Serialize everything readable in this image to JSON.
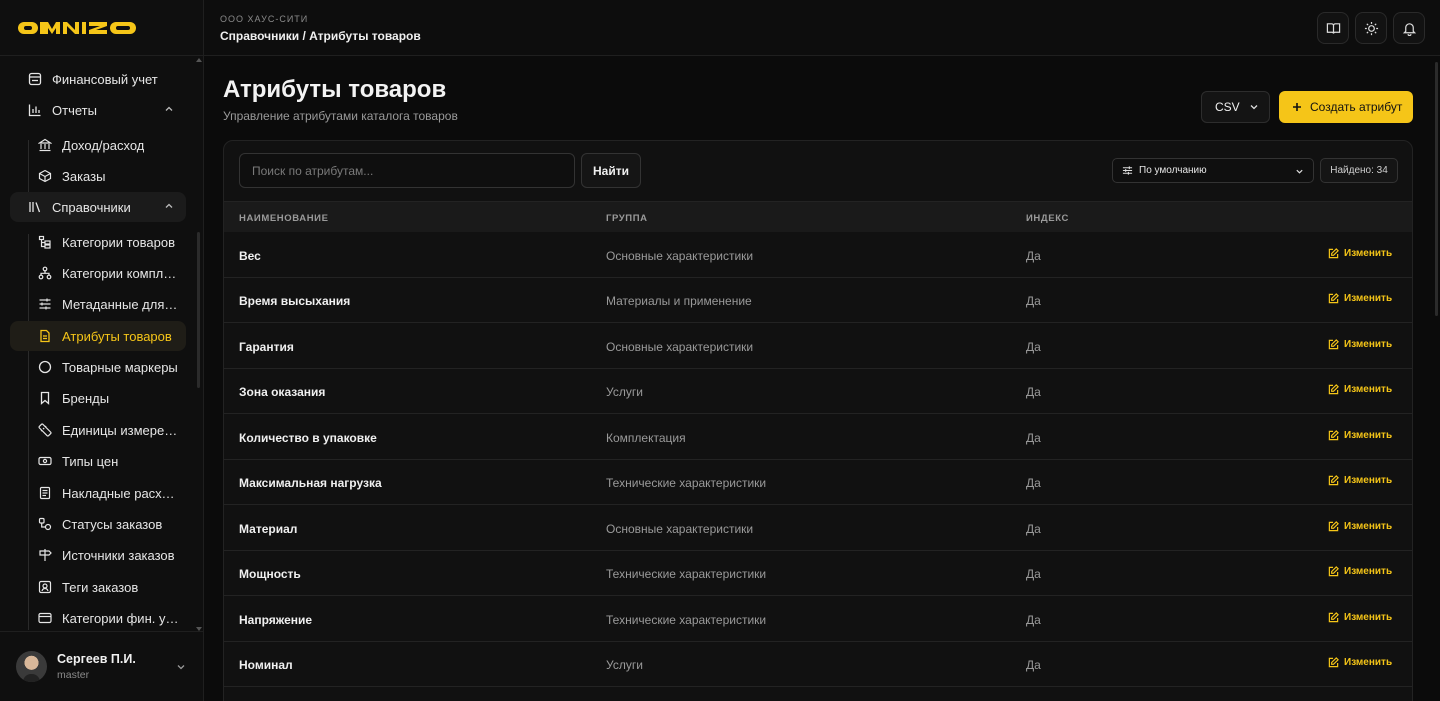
{
  "brand": {
    "logo_text": "OMNIZ",
    "accent": "#f5c518"
  },
  "header": {
    "org": "ООО ХАУС-СИТИ",
    "breadcrumb": "Справочники / Атрибуты товаров",
    "icons": [
      "book-icon",
      "sun-icon",
      "bell-icon"
    ]
  },
  "sidebar": {
    "items": [
      {
        "label": "Финансовый учет",
        "icon": "ledger-icon",
        "level": "top"
      },
      {
        "label": "Отчеты",
        "icon": "bar-chart-icon",
        "level": "top",
        "expanded": true
      },
      {
        "label": "Доход/расход",
        "icon": "bank-icon",
        "level": "sub"
      },
      {
        "label": "Заказы",
        "icon": "box-icon",
        "level": "sub"
      },
      {
        "label": "Справочники",
        "icon": "library-icon",
        "level": "top",
        "expanded": true
      },
      {
        "label": "Категории товаров",
        "icon": "category-tree-icon",
        "level": "sub"
      },
      {
        "label": "Категории комплектаций",
        "icon": "hierarchy-icon",
        "level": "sub"
      },
      {
        "label": "Метаданные для выгрузки",
        "icon": "sliders-icon",
        "level": "sub"
      },
      {
        "label": "Атрибуты товаров",
        "icon": "document-icon",
        "level": "sub",
        "active": true
      },
      {
        "label": "Товарные маркеры",
        "icon": "circle-icon",
        "level": "sub"
      },
      {
        "label": "Бренды",
        "icon": "bookmark-icon",
        "level": "sub"
      },
      {
        "label": "Единицы измерения",
        "icon": "ruler-icon",
        "level": "sub"
      },
      {
        "label": "Типы цен",
        "icon": "banknote-icon",
        "level": "sub"
      },
      {
        "label": "Накладные расходы",
        "icon": "receipt-icon",
        "level": "sub"
      },
      {
        "label": "Статусы заказов",
        "icon": "status-flow-icon",
        "level": "sub"
      },
      {
        "label": "Источники заказов",
        "icon": "signpost-icon",
        "level": "sub"
      },
      {
        "label": "Теги заказов",
        "icon": "tag-box-icon",
        "level": "sub"
      },
      {
        "label": "Категории фин. учета",
        "icon": "card-icon",
        "level": "sub"
      }
    ],
    "user": {
      "name": "Сергеев П.И.",
      "role": "master"
    }
  },
  "page": {
    "title": "Атрибуты товаров",
    "subtitle": "Управление атрибутами каталога товаров",
    "csv_label": "CSV",
    "create_label": "Создать атрибут"
  },
  "toolbar": {
    "search_placeholder": "Поиск по атрибутам...",
    "find_label": "Найти",
    "sort_label": "По умолчанию",
    "found_label": "Найдено: 34"
  },
  "table": {
    "columns": [
      "Наименование",
      "Группа",
      "Индекс"
    ],
    "edit_label": "Изменить",
    "rows": [
      {
        "name": "Вес",
        "group": "Основные характеристики",
        "index": "Да"
      },
      {
        "name": "Время высыхания",
        "group": "Материалы и применение",
        "index": "Да"
      },
      {
        "name": "Гарантия",
        "group": "Основные характеристики",
        "index": "Да"
      },
      {
        "name": "Зона оказания",
        "group": "Услуги",
        "index": "Да"
      },
      {
        "name": "Количество в упаковке",
        "group": "Комплектация",
        "index": "Да"
      },
      {
        "name": "Максимальная нагрузка",
        "group": "Технические характеристики",
        "index": "Да"
      },
      {
        "name": "Материал",
        "group": "Основные характеристики",
        "index": "Да"
      },
      {
        "name": "Мощность",
        "group": "Технические характеристики",
        "index": "Да"
      },
      {
        "name": "Напряжение",
        "group": "Технические характеристики",
        "index": "Да"
      },
      {
        "name": "Номинал",
        "group": "Услуги",
        "index": "Да"
      }
    ]
  }
}
